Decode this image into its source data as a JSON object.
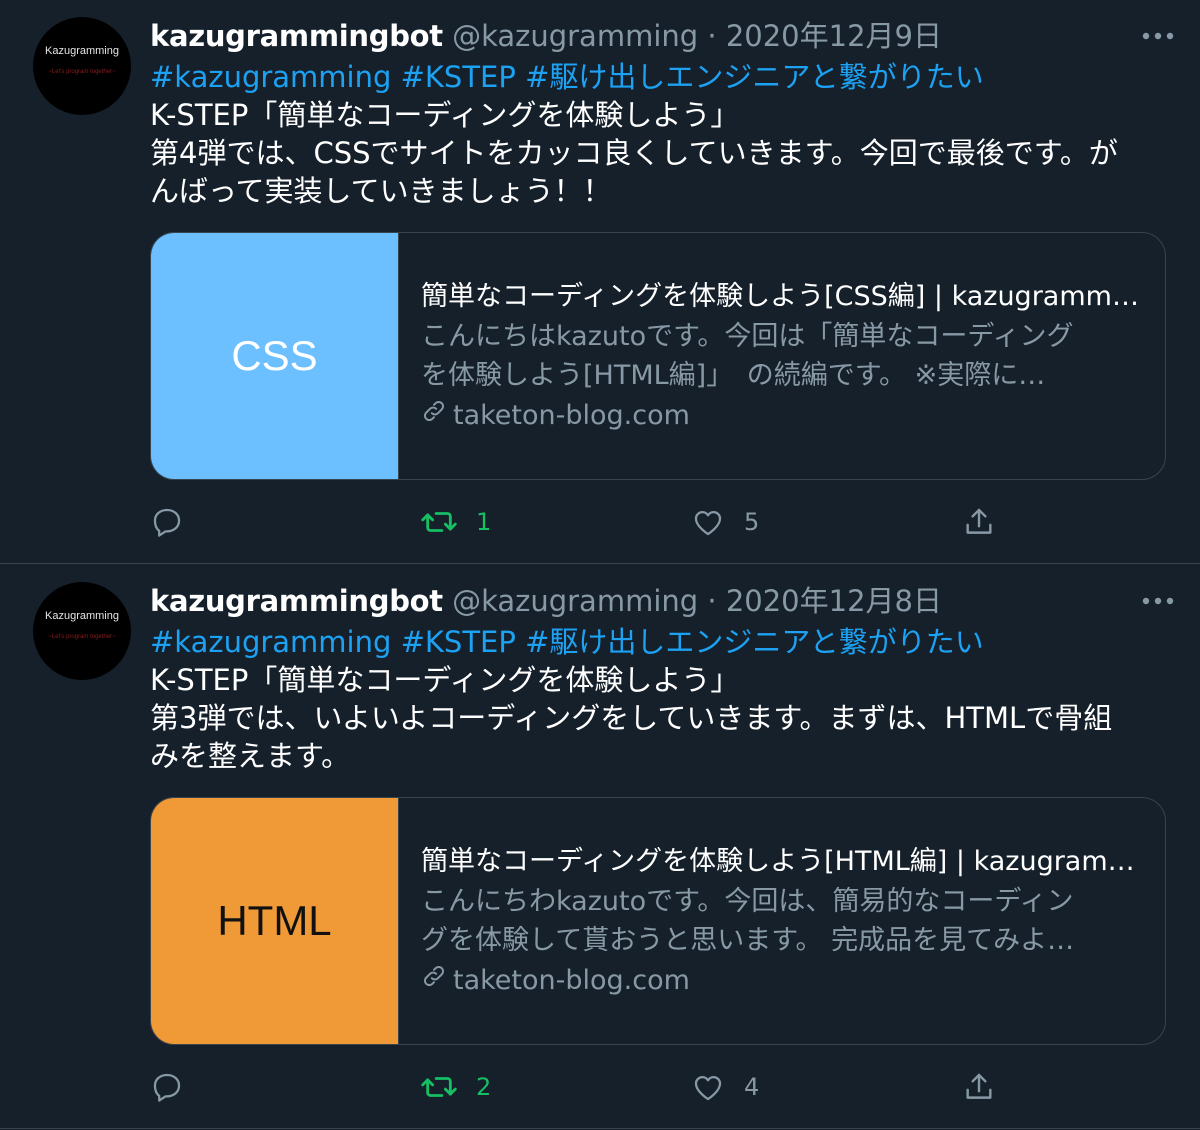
{
  "tweets": [
    {
      "avatar": {
        "name": "Kazugramming",
        "tagline": "~Let's program together~"
      },
      "display_name": "kazugrammingbot",
      "handle": "@kazugramming",
      "separator": "·",
      "date": "2020年12月9日",
      "hashtags": "#kazugramming #KSTEP #駆け出しエンジニアと繋がりたい",
      "lines": [
        "K-STEP「簡単なコーディングを体験しよう」",
        "第4弾では、CSSでサイトをカッコ良くしていきます。今回で最後です。が",
        "んばって実装していきましょう！！"
      ],
      "card": {
        "thumb_label": "CSS",
        "thumb_bg": "#6cc0ff",
        "thumb_fg": "#ffffff",
        "title": "簡単なコーディングを体験しよう[CSS編] | kazugramming",
        "desc_line1": "こんにちはkazutoです。今回は「簡単なコーディング",
        "desc_line2": "を体験しよう[HTML編]」　の続編です。 ※実際に…",
        "domain": "taketon-blog.com"
      },
      "reply_count": "",
      "retweet_count": "1",
      "like_count": "5"
    },
    {
      "avatar": {
        "name": "Kazugramming",
        "tagline": "~Let's program together~"
      },
      "display_name": "kazugrammingbot",
      "handle": "@kazugramming",
      "separator": "·",
      "date": "2020年12月8日",
      "hashtags": "#kazugramming #KSTEP #駆け出しエンジニアと繋がりたい",
      "lines": [
        "K-STEP「簡単なコーディングを体験しよう」",
        "第3弾では、いよいよコーディングをしていきます。まずは、HTMLで骨組",
        "みを整えます。"
      ],
      "card": {
        "thumb_label": "HTML",
        "thumb_bg": "#f09a37",
        "thumb_fg": "#111111",
        "title": "簡単なコーディングを体験しよう[HTML編] | kazugramming",
        "desc_line1": "こんにちわkazutoです。今回は、簡易的なコーディン",
        "desc_line2": "グを体験して貰おうと思います。 完成品を見てみよ…",
        "domain": "taketon-blog.com"
      },
      "reply_count": "",
      "retweet_count": "2",
      "like_count": "4"
    }
  ],
  "colors": {
    "background": "#15202b",
    "border": "#38444d",
    "muted": "#8899a6",
    "link": "#1da1f2",
    "retweet": "#17bf63"
  },
  "icons": [
    "more-icon",
    "reply-icon",
    "retweet-icon",
    "like-icon",
    "share-icon",
    "link-icon"
  ]
}
